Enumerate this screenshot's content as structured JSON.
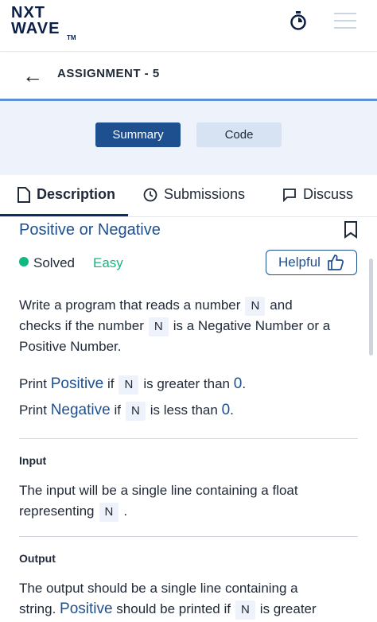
{
  "brand": {
    "line1": "NXT",
    "line2": "WAVE",
    "tm": "TM"
  },
  "header": {
    "title": "ASSIGNMENT - 5"
  },
  "view_toggle": {
    "summary": "Summary",
    "code": "Code"
  },
  "tabs": [
    {
      "label": "Description",
      "icon": "document-icon"
    },
    {
      "label": "Submissions",
      "icon": "clock-icon"
    },
    {
      "label": "Discuss",
      "icon": "chat-icon"
    }
  ],
  "problem": {
    "title": "Positive or Negative",
    "status": "Solved",
    "difficulty": "Easy",
    "helpful_label": "Helpful",
    "colors": {
      "solved": "#10b981",
      "accent": "#1e4f8f"
    }
  },
  "description": {
    "p1_a": "Write a program that reads a number",
    "p1_code1": "N",
    "p1_b": "and",
    "p1_c": "checks if the number",
    "p1_code2": "N",
    "p1_d": "is a Negative Number or a",
    "p1_e": "Positive Number.",
    "l1_a": "Print",
    "l1_kw": "Positive",
    "l1_b": "if",
    "l1_code": "N",
    "l1_c": "is greater than",
    "l1_zero": "0",
    "l1_dot": ".",
    "l2_a": "Print",
    "l2_kw": "Negative",
    "l2_b": "if",
    "l2_code": "N",
    "l2_c": "is less than",
    "l2_zero": "0",
    "l2_dot": "."
  },
  "input_section": {
    "label": "Input",
    "text_a": "The input will be a single line containing a float",
    "text_b": "representing",
    "code": "N",
    "dot": "."
  },
  "output_section": {
    "label": "Output",
    "text_a": "The output should be a single line containing a",
    "text_b": "string.",
    "kw": "Positive",
    "text_c": "should be printed if",
    "code": "N",
    "text_d": "is greater"
  }
}
